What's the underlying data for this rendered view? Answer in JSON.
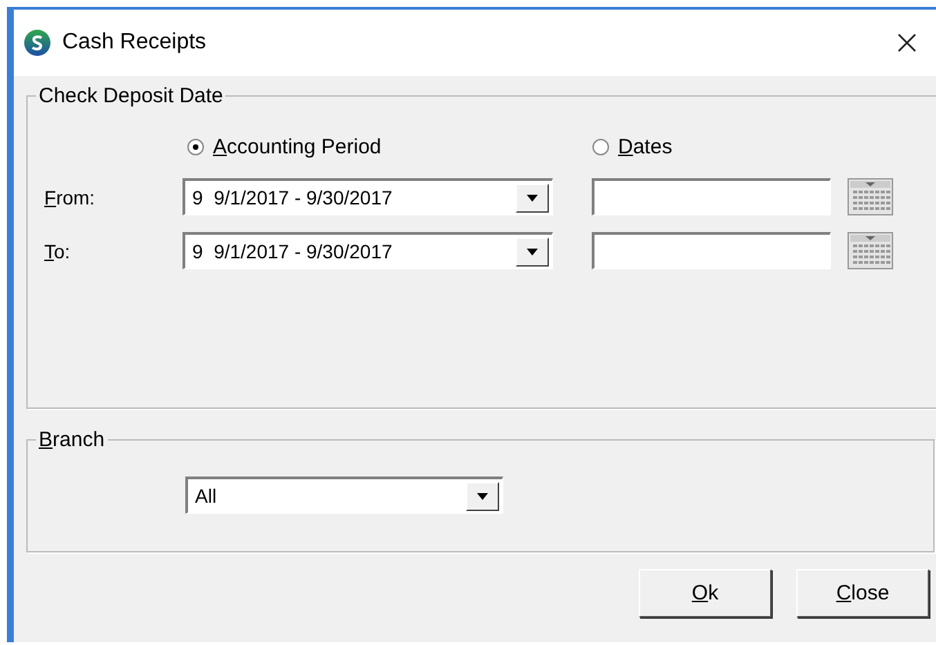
{
  "window": {
    "title": "Cash Receipts"
  },
  "deposit_date": {
    "legend": "Check Deposit Date",
    "modes": [
      {
        "label": "Accounting Period",
        "selected": true
      },
      {
        "label": "Dates",
        "selected": false
      }
    ],
    "rows": [
      {
        "label": "From:",
        "period": "9  9/1/2017 - 9/30/2017"
      },
      {
        "label": "To:",
        "period": "9  9/1/2017 - 9/30/2017"
      }
    ]
  },
  "branch": {
    "legend": "Branch",
    "value": "All"
  },
  "buttons": [
    {
      "label": "Ok"
    },
    {
      "label": "Close"
    }
  ]
}
